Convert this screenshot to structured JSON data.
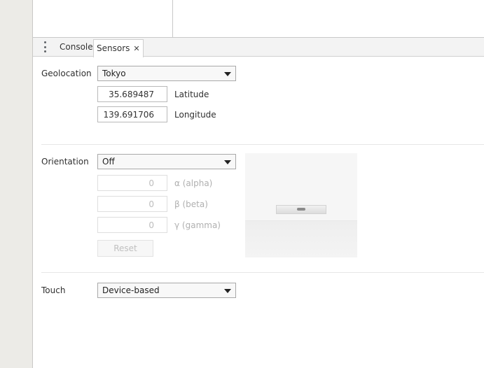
{
  "drawer": {
    "tabs": [
      {
        "label": "Console"
      },
      {
        "label": "Sensors",
        "close_glyph": "✕"
      }
    ]
  },
  "geolocation": {
    "label": "Geolocation",
    "selected": "Tokyo",
    "latitude": {
      "value": "35.689487",
      "label": "Latitude"
    },
    "longitude": {
      "value": "139.691706",
      "label": "Longitude"
    }
  },
  "orientation": {
    "label": "Orientation",
    "selected": "Off",
    "alpha": {
      "value": "0",
      "label": "α (alpha)"
    },
    "beta": {
      "value": "0",
      "label": "β (beta)"
    },
    "gamma": {
      "value": "0",
      "label": "γ (gamma)"
    },
    "reset_label": "Reset"
  },
  "touch": {
    "label": "Touch",
    "selected": "Device-based"
  },
  "icons": {
    "menu": "more-vertical-icon",
    "close": "close-icon",
    "caret": "chevron-down-icon"
  },
  "colors": {
    "gutter": "#ecebe7",
    "tabstrip": "#f3f3f3",
    "border": "#a9a9a9",
    "disabled_text": "#bdbdbd"
  }
}
